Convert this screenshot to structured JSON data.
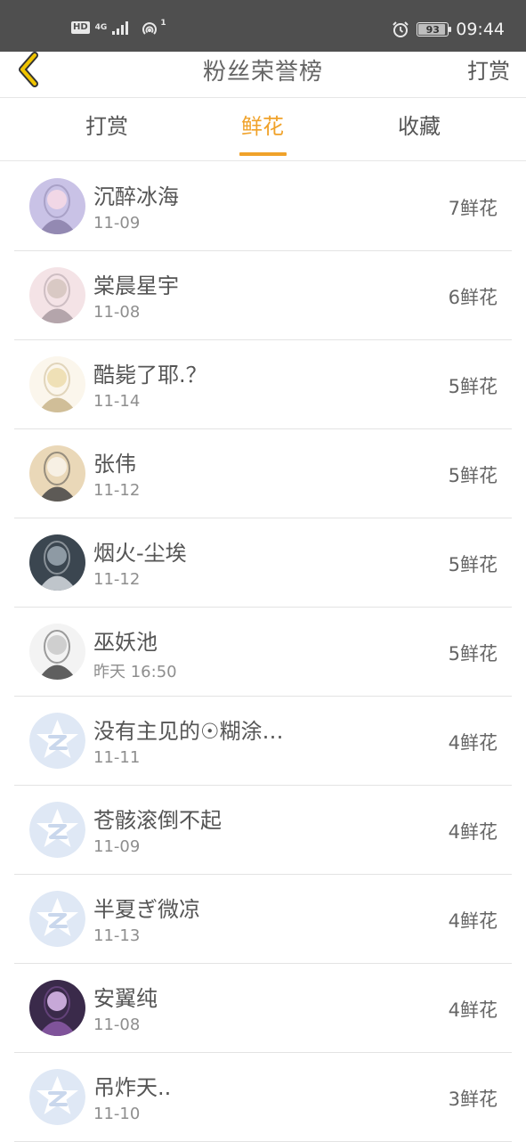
{
  "status_bar": {
    "hd_label": "HD",
    "network_label": "4G",
    "hotspot_count": "1",
    "battery_percent": "93",
    "battery_level": 0.93,
    "time": "09:44",
    "icons": [
      "hd-icon",
      "signal-icon",
      "hotspot-icon",
      "alarm-icon",
      "battery-icon"
    ]
  },
  "header": {
    "title": "粉丝荣誉榜",
    "action_label": "打赏",
    "back_icon": "chevron-left-icon",
    "accent_color": "#f0c400"
  },
  "tabs": [
    {
      "label": "打赏",
      "active": false
    },
    {
      "label": "鲜花",
      "active": true
    },
    {
      "label": "收藏",
      "active": false
    }
  ],
  "tab_active_color": "#f0a22a",
  "fans": [
    {
      "name": "沉醉冰海",
      "date": "11-09",
      "count": "7鲜花",
      "avatar": "photo-avatar"
    },
    {
      "name": "棠晨星宇",
      "date": "11-08",
      "count": "6鲜花",
      "avatar": "photo-avatar"
    },
    {
      "name": "酷毙了耶.？",
      "date": "11-14",
      "count": "5鲜花",
      "avatar": "photo-avatar"
    },
    {
      "name": "张伟",
      "date": "11-12",
      "count": "5鲜花",
      "avatar": "photo-avatar"
    },
    {
      "name": "烟火-尘埃",
      "date": "11-12",
      "count": "5鲜花",
      "avatar": "photo-avatar"
    },
    {
      "name": "巫妖池",
      "date": "昨天 16:50",
      "count": "5鲜花",
      "avatar": "photo-avatar"
    },
    {
      "name": "没有主见的☉糊涂…",
      "date": "11-11",
      "count": "4鲜花",
      "avatar": "default-star-avatar"
    },
    {
      "name": "苍骸滚倒不起",
      "date": "11-09",
      "count": "4鲜花",
      "avatar": "default-star-avatar"
    },
    {
      "name": "半夏ぎ微凉",
      "date": "11-13",
      "count": "4鲜花",
      "avatar": "default-star-avatar"
    },
    {
      "name": "安翼纯",
      "date": "11-08",
      "count": "4鲜花",
      "avatar": "photo-avatar"
    },
    {
      "name": "吊炸天..",
      "date": "11-10",
      "count": "3鲜花",
      "avatar": "default-star-avatar"
    }
  ]
}
